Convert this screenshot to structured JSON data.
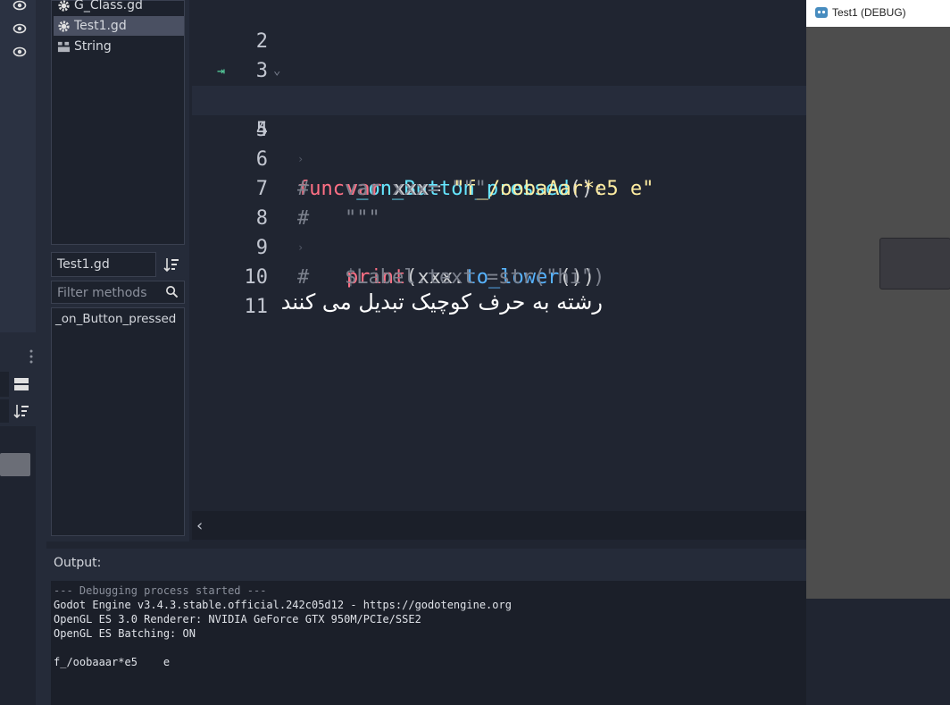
{
  "script_list": {
    "items": [
      {
        "label": "G_Class.gd",
        "icon": "gear-icon"
      },
      {
        "label": "Test1.gd",
        "icon": "gear-icon",
        "selected": true
      },
      {
        "label": "String",
        "icon": "doc-icon"
      }
    ]
  },
  "file_name": "Test1.gd",
  "filter": {
    "placeholder": "Filter methods"
  },
  "methods": [
    "_on_Button_pressed"
  ],
  "editor": {
    "line_numbers": [
      "2",
      "3",
      "4",
      "5",
      "6",
      "7",
      "8",
      "9",
      "10",
      "11"
    ],
    "current_line": "5",
    "code": {
      "l4_kw": "func",
      "l4_fn": "_on_Button_pressed",
      "l4_rest": "():",
      "l5_kw": "var",
      "l5_id": "xxx=",
      "l5_str": "\"f_/oobaAar*e5 e\"",
      "l6": "#   var xxx= \"\"\"",
      "l7": "#   \"\"\"",
      "l8_fn": "print",
      "l8_p1": "(xxx.",
      "l8_m": "to_lower",
      "l8_p2": "())",
      "l9": "#   $Label.text =str(\"hi\")"
    },
    "annotation": "رشته به حرف کوچیک تبدیل می کنند"
  },
  "output": {
    "title": "Output:",
    "lines": [
      "--- Debugging process started ---",
      "Godot Engine v3.4.3.stable.official.242c05d12 - https://godotengine.org",
      "OpenGL ES 3.0 Renderer: NVIDIA GeForce GTX 950M/PCIe/SSE2",
      "OpenGL ES Batching: ON",
      "",
      "f_/oobaaar*e5    e"
    ]
  },
  "debug_window": {
    "title": "Test1 (DEBUG)"
  },
  "colors": {
    "keyword": "#ff7085",
    "function": "#66e6ff",
    "method": "#57b3ff",
    "string": "#ffeda1",
    "comment": "#7c818d",
    "breakpoint_arrow": "#56d29f"
  }
}
